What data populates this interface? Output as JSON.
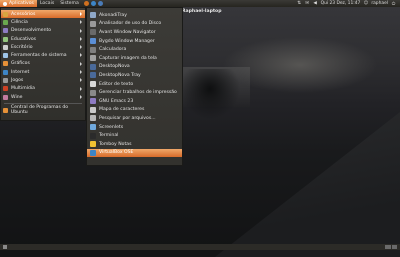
{
  "top_panel": {
    "menus": [
      {
        "label": "Aplicativos",
        "active": true
      },
      {
        "label": "Locais",
        "active": false
      },
      {
        "label": "Sistema",
        "active": false
      }
    ],
    "clock": "Qui 23 Dez, 11:47",
    "user": "raphael"
  },
  "desktop": {
    "title": "Raphael-laptop"
  },
  "apps_menu": {
    "items": [
      {
        "label": "Acessórios",
        "icon": "accessories-icon",
        "color": "#d9a441",
        "highlighted": true,
        "has_submenu": true
      },
      {
        "label": "Ciência",
        "icon": "science-icon",
        "color": "#6aa84f",
        "highlighted": false,
        "has_submenu": true
      },
      {
        "label": "Desenvolvimento",
        "icon": "development-icon",
        "color": "#8e7cc3",
        "highlighted": false,
        "has_submenu": true
      },
      {
        "label": "Educativos",
        "icon": "education-icon",
        "color": "#93c47d",
        "highlighted": false,
        "has_submenu": true
      },
      {
        "label": "Escritório",
        "icon": "office-icon",
        "color": "#cfcfcf",
        "highlighted": false,
        "has_submenu": true
      },
      {
        "label": "Ferramentas de sistema",
        "icon": "system-tools-icon",
        "color": "#9fc5e8",
        "highlighted": false,
        "has_submenu": true
      },
      {
        "label": "Gráficos",
        "icon": "graphics-icon",
        "color": "#e69138",
        "highlighted": false,
        "has_submenu": true
      },
      {
        "label": "Internet",
        "icon": "internet-icon",
        "color": "#3d85c6",
        "highlighted": false,
        "has_submenu": true
      },
      {
        "label": "Jogos",
        "icon": "games-icon",
        "color": "#999999",
        "highlighted": false,
        "has_submenu": true
      },
      {
        "label": "Multimídia",
        "icon": "multimedia-icon",
        "color": "#cc4125",
        "highlighted": false,
        "has_submenu": true
      },
      {
        "label": "Wine",
        "icon": "wine-icon",
        "color": "#c27ba0",
        "highlighted": false,
        "has_submenu": true
      }
    ],
    "footer": {
      "label": "Central de Programas do Ubuntu",
      "icon": "software-center-icon",
      "color": "#e69138"
    }
  },
  "submenu": {
    "items": [
      {
        "label": "AkonadiTray",
        "icon": "akonadi-icon",
        "color": "#8fa8c8",
        "highlighted": false
      },
      {
        "label": "Analisador de uso do Disco",
        "icon": "disk-usage-icon",
        "color": "#9a9a9a",
        "highlighted": false
      },
      {
        "label": "Avant Window Navigator",
        "icon": "awn-icon",
        "color": "#6a6a6a",
        "highlighted": false
      },
      {
        "label": "Bygdo Window Manager",
        "icon": "window-manager-icon",
        "color": "#5b8fd6",
        "highlighted": false
      },
      {
        "label": "Calculadora",
        "icon": "calculator-icon",
        "color": "#7f7f7f",
        "highlighted": false
      },
      {
        "label": "Capturar imagem da tela",
        "icon": "screenshot-icon",
        "color": "#a0a0a0",
        "highlighted": false
      },
      {
        "label": "DesktopNova",
        "icon": "desktopnova-icon",
        "color": "#4a6a9a",
        "highlighted": false
      },
      {
        "label": "DesktopNova Tray",
        "icon": "desktopnova-tray-icon",
        "color": "#4a6a9a",
        "highlighted": false
      },
      {
        "label": "Editor de texto",
        "icon": "text-editor-icon",
        "color": "#d8d8d8",
        "highlighted": false
      },
      {
        "label": "Gerenciar trabalhos de impressão",
        "icon": "printer-icon",
        "color": "#8a8a8a",
        "highlighted": false
      },
      {
        "label": "GNU Emacs 23",
        "icon": "emacs-icon",
        "color": "#8e7cc3",
        "highlighted": false
      },
      {
        "label": "Mapa de caracteres",
        "icon": "charmap-icon",
        "color": "#c9c9c9",
        "highlighted": false
      },
      {
        "label": "Pesquisar por arquivos...",
        "icon": "search-icon",
        "color": "#b7b7b7",
        "highlighted": false
      },
      {
        "label": "Screenlets",
        "icon": "screenlets-icon",
        "color": "#6fa8dc",
        "highlighted": false
      },
      {
        "label": "Terminal",
        "icon": "terminal-icon",
        "color": "#2b2b2b",
        "highlighted": false
      },
      {
        "label": "Tomboy Notas",
        "icon": "tomboy-icon",
        "color": "#f1c232",
        "highlighted": false
      },
      {
        "label": "VirtualBox OSE",
        "icon": "virtualbox-icon",
        "color": "#3d85c6",
        "highlighted": true
      }
    ]
  }
}
